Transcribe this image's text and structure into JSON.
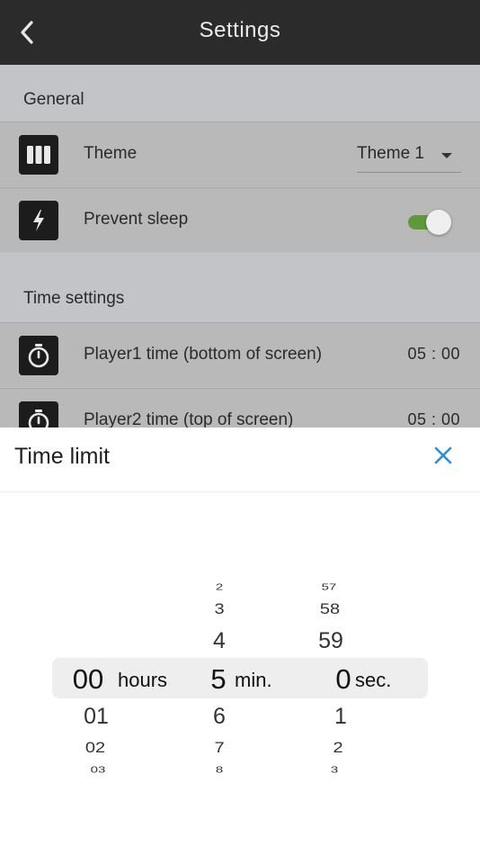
{
  "header": {
    "title": "Settings",
    "back_icon": "chevron-left-icon"
  },
  "general": {
    "label": "General",
    "theme": {
      "label": "Theme",
      "value": "Theme 1",
      "icon": "theme-columns-icon"
    },
    "prevent_sleep": {
      "label": "Prevent sleep",
      "enabled": true,
      "icon": "lightning-icon",
      "accent": "#5f9a3a"
    }
  },
  "time_settings": {
    "label": "Time settings",
    "player1": {
      "label": "Player1 time (bottom of screen)",
      "value": "05 : 00",
      "icon": "stopwatch-icon"
    },
    "player2": {
      "label": "Player2 time (top of screen)",
      "value": "05 : 00",
      "icon": "stopwatch-icon"
    }
  },
  "time_limit": {
    "title": "Time limit",
    "close_icon": "close-icon",
    "close_color": "#2b8ede",
    "hours": {
      "above": [],
      "selected": "00",
      "below": [
        "01",
        "02",
        "03"
      ],
      "unit": "hours"
    },
    "minutes": {
      "above": [
        "2",
        "3",
        "4"
      ],
      "selected": "5",
      "below": [
        "6",
        "7",
        "8"
      ],
      "unit": "min."
    },
    "seconds": {
      "above": [
        "57",
        "58",
        "59"
      ],
      "selected": "0",
      "below": [
        "1",
        "2",
        "3"
      ],
      "unit": "sec."
    }
  }
}
